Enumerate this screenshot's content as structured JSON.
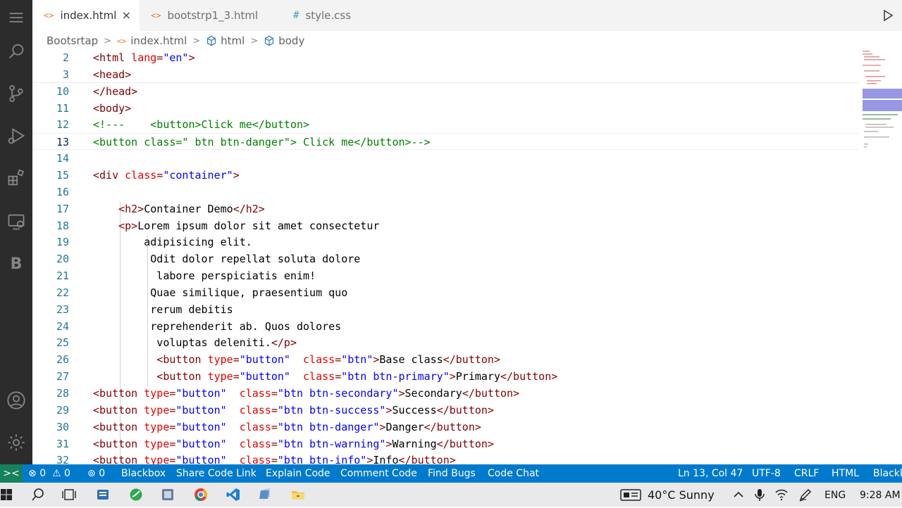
{
  "tabs": [
    {
      "label": "index.html",
      "icon": "<>",
      "active": true
    },
    {
      "label": "bootstrp1_3.html",
      "icon": "<>",
      "active": false
    },
    {
      "label": "style.css",
      "icon": "#",
      "active": false
    }
  ],
  "tab_close": "×",
  "breadcrumb": {
    "folder": "Bootsrtap",
    "file": "index.html",
    "html": "html",
    "body": "body",
    "sep": ">"
  },
  "code_lines": [
    {
      "num": "2",
      "tokens": [
        [
          "tag",
          "<html "
        ],
        [
          "attr",
          "lang"
        ],
        [
          "tag",
          "="
        ],
        [
          "str",
          "\"en\""
        ],
        [
          "tag",
          ">"
        ]
      ]
    },
    {
      "num": "3",
      "tokens": [
        [
          "tag",
          "<head>"
        ]
      ]
    },
    {
      "num": "10",
      "tokens": [
        [
          "tag",
          "</head>"
        ]
      ]
    },
    {
      "num": "11",
      "tokens": [
        [
          "tag",
          "<body>"
        ]
      ]
    },
    {
      "num": "12",
      "tokens": [
        [
          "cm",
          "<!---    <button>Click me</button>"
        ]
      ]
    },
    {
      "num": "13",
      "tokens": [
        [
          "cm",
          "<button class=\" btn btn-danger\"> Click me</button>-->"
        ]
      ]
    },
    {
      "num": "14",
      "tokens": []
    },
    {
      "num": "15",
      "tokens": [
        [
          "tag",
          "<div "
        ],
        [
          "attr",
          "class"
        ],
        [
          "tag",
          "="
        ],
        [
          "str",
          "\"container\""
        ],
        [
          "tag",
          ">"
        ]
      ]
    },
    {
      "num": "16",
      "tokens": []
    },
    {
      "num": "17",
      "tokens": [
        [
          "plain",
          "    "
        ],
        [
          "tag",
          "<h2>"
        ],
        [
          "plain",
          "Container Demo"
        ],
        [
          "tag",
          "</h2>"
        ]
      ]
    },
    {
      "num": "18",
      "tokens": [
        [
          "plain",
          "    "
        ],
        [
          "tag",
          "<p>"
        ],
        [
          "plain",
          "Lorem ipsum dolor sit amet consectetur"
        ]
      ]
    },
    {
      "num": "19",
      "tokens": [
        [
          "plain",
          "        adipisicing elit."
        ]
      ]
    },
    {
      "num": "20",
      "tokens": [
        [
          "plain",
          "         Odit dolor repellat soluta dolore"
        ]
      ]
    },
    {
      "num": "21",
      "tokens": [
        [
          "plain",
          "          labore perspiciatis enim!"
        ]
      ]
    },
    {
      "num": "22",
      "tokens": [
        [
          "plain",
          "         Quae similique, praesentium quo"
        ]
      ]
    },
    {
      "num": "23",
      "tokens": [
        [
          "plain",
          "         rerum debitis"
        ]
      ]
    },
    {
      "num": "24",
      "tokens": [
        [
          "plain",
          "         reprehenderit ab. Quos dolores"
        ]
      ]
    },
    {
      "num": "25",
      "tokens": [
        [
          "plain",
          "          voluptas deleniti."
        ],
        [
          "tag",
          "</p>"
        ]
      ]
    },
    {
      "num": "26",
      "tokens": [
        [
          "plain",
          "          "
        ],
        [
          "tag",
          "<button "
        ],
        [
          "attr",
          "type"
        ],
        [
          "tag",
          "="
        ],
        [
          "str",
          "\"button\""
        ],
        [
          "plain",
          "  "
        ],
        [
          "attr",
          "class"
        ],
        [
          "tag",
          "="
        ],
        [
          "str",
          "\"btn\""
        ],
        [
          "tag",
          ">"
        ],
        [
          "plain",
          "Base class"
        ],
        [
          "tag",
          "</button>"
        ]
      ]
    },
    {
      "num": "27",
      "tokens": [
        [
          "plain",
          "          "
        ],
        [
          "tag",
          "<button "
        ],
        [
          "attr",
          "type"
        ],
        [
          "tag",
          "="
        ],
        [
          "str",
          "\"button\""
        ],
        [
          "plain",
          "  "
        ],
        [
          "attr",
          "class"
        ],
        [
          "tag",
          "="
        ],
        [
          "str",
          "\"btn btn-primary\""
        ],
        [
          "tag",
          ">"
        ],
        [
          "plain",
          "Primary"
        ],
        [
          "tag",
          "</button>"
        ]
      ]
    },
    {
      "num": "28",
      "tokens": [
        [
          "tag",
          "<button "
        ],
        [
          "attr",
          "type"
        ],
        [
          "tag",
          "="
        ],
        [
          "str",
          "\"button\""
        ],
        [
          "plain",
          "  "
        ],
        [
          "attr",
          "class"
        ],
        [
          "tag",
          "="
        ],
        [
          "str",
          "\"btn btn-secondary\""
        ],
        [
          "tag",
          ">"
        ],
        [
          "plain",
          "Secondary"
        ],
        [
          "tag",
          "</button>"
        ]
      ]
    },
    {
      "num": "29",
      "tokens": [
        [
          "tag",
          "<button "
        ],
        [
          "attr",
          "type"
        ],
        [
          "tag",
          "="
        ],
        [
          "str",
          "\"button\""
        ],
        [
          "plain",
          "  "
        ],
        [
          "attr",
          "class"
        ],
        [
          "tag",
          "="
        ],
        [
          "str",
          "\"btn btn-success\""
        ],
        [
          "tag",
          ">"
        ],
        [
          "plain",
          "Success"
        ],
        [
          "tag",
          "</button>"
        ]
      ]
    },
    {
      "num": "30",
      "tokens": [
        [
          "tag",
          "<button "
        ],
        [
          "attr",
          "type"
        ],
        [
          "tag",
          "="
        ],
        [
          "str",
          "\"button\""
        ],
        [
          "plain",
          "  "
        ],
        [
          "attr",
          "class"
        ],
        [
          "tag",
          "="
        ],
        [
          "str",
          "\"btn btn-danger\""
        ],
        [
          "tag",
          ">"
        ],
        [
          "plain",
          "Danger"
        ],
        [
          "tag",
          "</button>"
        ]
      ]
    },
    {
      "num": "31",
      "tokens": [
        [
          "tag",
          "<button "
        ],
        [
          "attr",
          "type"
        ],
        [
          "tag",
          "="
        ],
        [
          "str",
          "\"button\""
        ],
        [
          "plain",
          "  "
        ],
        [
          "attr",
          "class"
        ],
        [
          "tag",
          "="
        ],
        [
          "str",
          "\"btn btn-warning\""
        ],
        [
          "tag",
          ">"
        ],
        [
          "plain",
          "Warning"
        ],
        [
          "tag",
          "</button>"
        ]
      ]
    },
    {
      "num": "32",
      "tokens": [
        [
          "tag",
          "<button "
        ],
        [
          "attr",
          "type"
        ],
        [
          "tag",
          "="
        ],
        [
          "str",
          "\"button\""
        ],
        [
          "plain",
          "  "
        ],
        [
          "attr",
          "class"
        ],
        [
          "tag",
          "="
        ],
        [
          "str",
          "\"btn btn-info\""
        ],
        [
          "tag",
          ">"
        ],
        [
          "plain",
          "Info"
        ],
        [
          "tag",
          "</button>"
        ]
      ]
    }
  ],
  "current_line": "13",
  "statusbar": {
    "remote": "><",
    "errors": "0",
    "warnings": "0",
    "ports": "0",
    "blackbox": "Blackbox",
    "share": "Share Code Link",
    "explain": "Explain Code",
    "comment": "Comment Code",
    "bugs": "Find Bugs",
    "chat": "Code Chat",
    "position": "Ln 13, Col 47",
    "encoding": "UTF-8",
    "eol": "CRLF",
    "language": "HTML",
    "right_blackbox": "Blackb"
  },
  "taskbar": {
    "weather": "40°C  Sunny",
    "lang": "ENG",
    "time": "9:28 AM"
  },
  "colors": {
    "activity_bar": "#2c2c2c",
    "status_bar": "#007acc",
    "tag": "#800000",
    "attr": "#e50000",
    "string": "#0000ff",
    "comment": "#008000"
  }
}
